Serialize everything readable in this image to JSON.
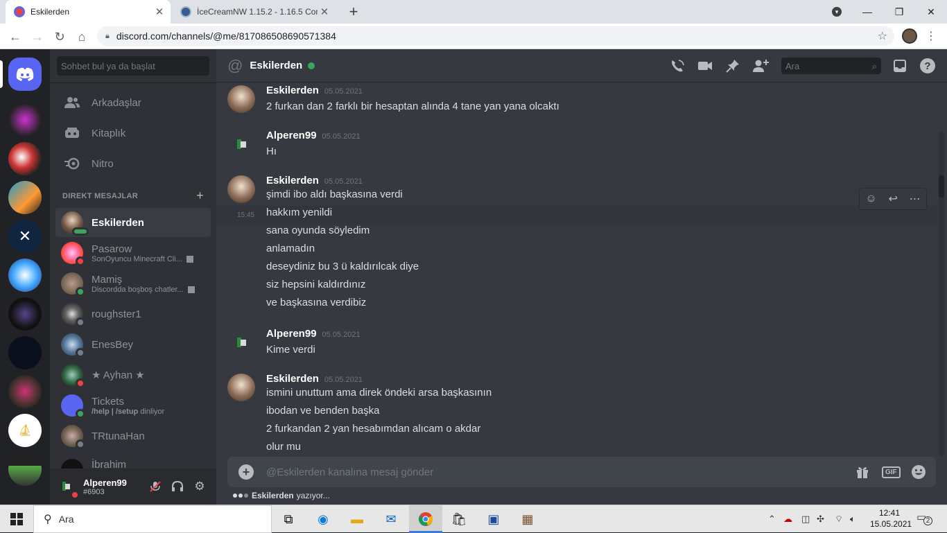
{
  "browser": {
    "tabs": [
      {
        "title": "Eskilerden",
        "active": true
      },
      {
        "title": "İceCreamNW 1.15.2 - 1.16.5 Con",
        "active": false
      }
    ],
    "url": "discord.com/channels/@me/817086508690571384"
  },
  "discord": {
    "dm_search_placeholder": "Sohbet bul ya da başlat",
    "nav": [
      {
        "label": "Arkadaşlar",
        "icon": "friends-icon"
      },
      {
        "label": "Kitaplık",
        "icon": "library-icon"
      },
      {
        "label": "Nitro",
        "icon": "nitro-icon"
      }
    ],
    "dm_header": "DIREKT MESAJLAR",
    "dms": [
      {
        "name": "Eskilerden",
        "sub": "",
        "status": "mobile",
        "active": true
      },
      {
        "name": "Pasarow",
        "sub": "SonOyuncu Minecraft Cli...",
        "status": "dnd"
      },
      {
        "name": "Mamiş",
        "sub": "Discordda boşboş chatler...",
        "status": "online"
      },
      {
        "name": "roughster1",
        "sub": "",
        "status": "offline"
      },
      {
        "name": "EnesBey",
        "sub": "",
        "status": "offline"
      },
      {
        "name": "★ Ayhan ★",
        "sub": "",
        "status": "dnd"
      },
      {
        "name": "Tickets",
        "sub_bold": "/help | /setup",
        "sub": " dinliyor",
        "status": "online"
      },
      {
        "name": "TRtunaHan",
        "sub": "",
        "status": "offline"
      },
      {
        "name": "İbrahim",
        "sub": "",
        "status": "offline"
      }
    ],
    "user": {
      "name": "Alperen99",
      "tag": "#6903"
    },
    "channel": {
      "name": "Eskilerden",
      "search_placeholder": "Ara"
    },
    "messages": [
      {
        "author": "Eskilerden",
        "date": "05.05.2021",
        "lines": [
          "2 furkan dan 2 farklı bir hesaptan alında 4 tane yan yana olcaktı"
        ]
      },
      {
        "author": "Alperen99",
        "date": "05.05.2021",
        "lines": [
          "Hı"
        ]
      },
      {
        "author": "Eskilerden",
        "date": "05.05.2021",
        "lines": [
          "şimdi ibo aldı başkasına verdi",
          "hakkım yenildi",
          "sana oyunda söyledim",
          "anlamadın",
          "deseydiniz bu 3 ü kaldırılcak diye",
          "siz hepsini kaldırdınız",
          "ve başkasına verdibiz"
        ]
      },
      {
        "author": "Alperen99",
        "date": "05.05.2021",
        "lines": [
          "Kime verdi"
        ]
      },
      {
        "author": "Eskilerden",
        "date": "05.05.2021",
        "lines": [
          "ismini unuttum ama direk öndeki arsa başkasının",
          "ibodan ve benden başka",
          "2 furkandan 2 yan hesabımdan alıcam o akdar",
          "olur mu"
        ]
      }
    ],
    "hover_time": "15:45",
    "composer_placeholder": "@Eskilerden kanalına mesaj gönder",
    "gif_label": "GIF",
    "typing_user": "Eskilerden",
    "typing_suffix": "yazıyor..."
  },
  "taskbar": {
    "search": "Ara",
    "time": "12:41",
    "date": "15.05.2021",
    "notifications": "2"
  },
  "colors": {
    "blurple": "#5865f2",
    "online": "#3ba55c",
    "dnd": "#ed4245"
  }
}
